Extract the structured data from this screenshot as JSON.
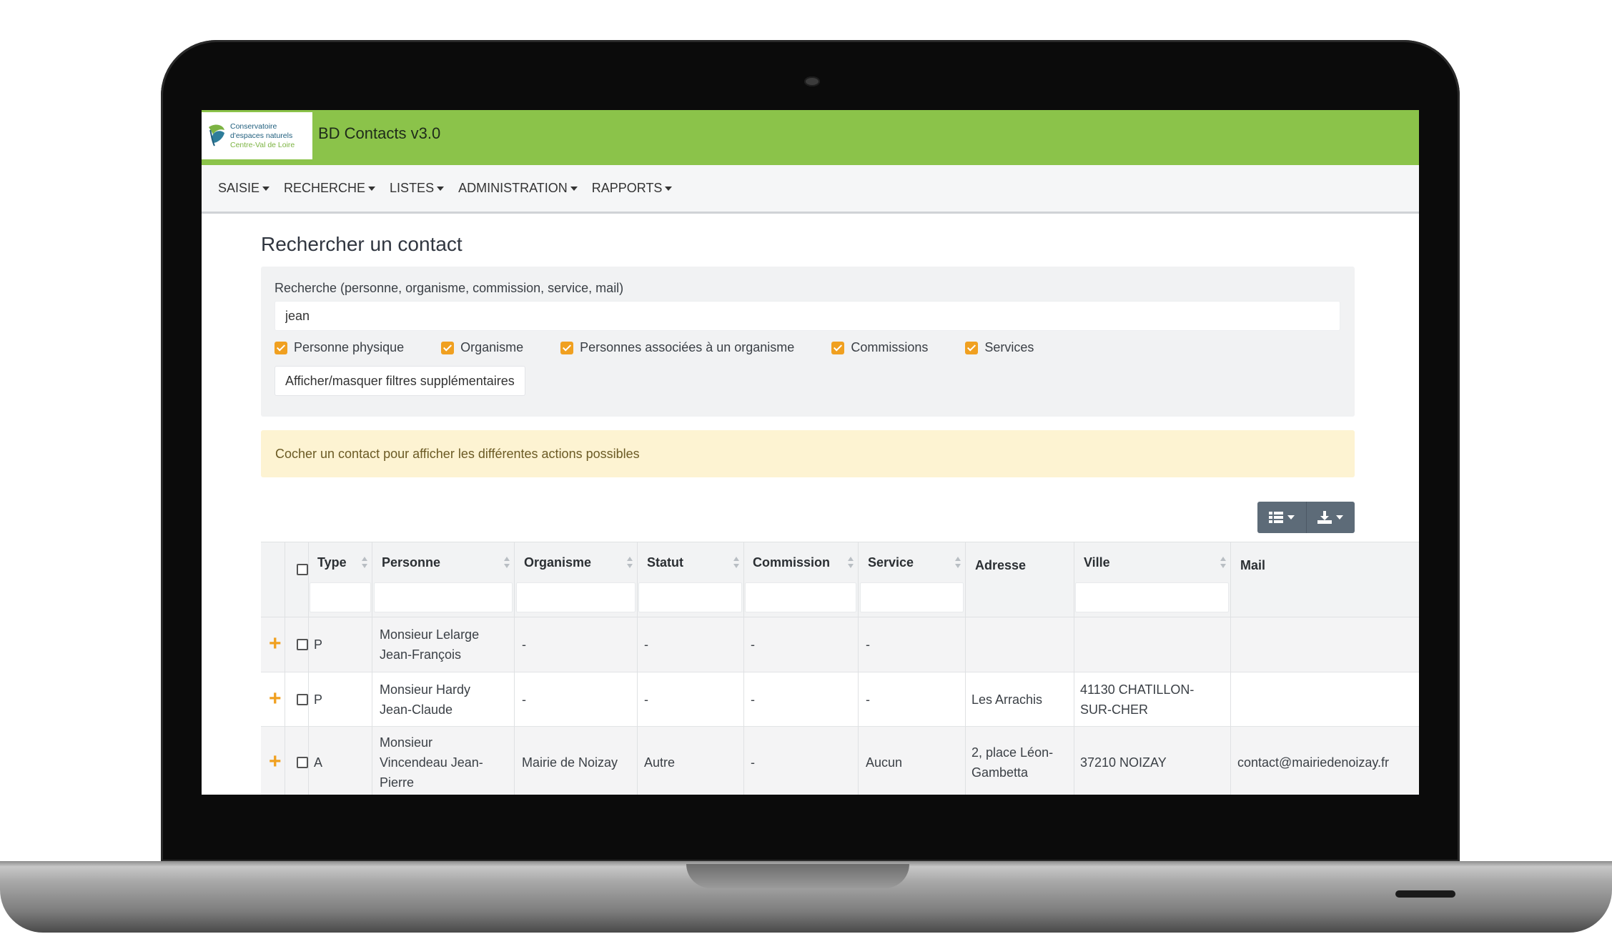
{
  "app": {
    "title": "BD Contacts v3.0",
    "logo_line1": "Conservatoire",
    "logo_line2": "d'espaces naturels",
    "logo_line3": "Centre-Val de Loire"
  },
  "nav": [
    "SAISIE",
    "RECHERCHE",
    "LISTES",
    "ADMINISTRATION",
    "RAPPORTS"
  ],
  "page": {
    "title": "Rechercher un contact"
  },
  "search": {
    "label": "Recherche (personne, organisme, commission, service, mail)",
    "value": "jean",
    "checkboxes": [
      "Personne physique",
      "Organisme",
      "Personnes associées à un organisme",
      "Commissions",
      "Services"
    ],
    "toggle_label": "Afficher/masquer filtres supplémentaires"
  },
  "alert": {
    "text": "Cocher un contact pour afficher les différentes actions possibles"
  },
  "table": {
    "columns": [
      "Type",
      "Personne",
      "Organisme",
      "Statut",
      "Commission",
      "Service",
      "Adresse",
      "Ville",
      "Mail"
    ],
    "rows": [
      {
        "type": "P",
        "personne": [
          "Monsieur Lelarge",
          "Jean-François"
        ],
        "organisme": "-",
        "statut": "-",
        "commission": "-",
        "service": "-",
        "adresse": [],
        "ville": [],
        "mail": ""
      },
      {
        "type": "P",
        "personne": [
          "Monsieur Hardy",
          "Jean-Claude"
        ],
        "organisme": "-",
        "statut": "-",
        "commission": "-",
        "service": "-",
        "adresse": [
          "Les Arrachis"
        ],
        "ville": [
          "41130 CHATILLON-",
          "SUR-CHER"
        ],
        "mail": ""
      },
      {
        "type": "A",
        "personne": [
          "Monsieur",
          "Vincendeau Jean-",
          "Pierre"
        ],
        "organisme": "Mairie de Noizay",
        "statut": "Autre",
        "commission": "-",
        "service": "Aucun",
        "adresse": [
          "2, place Léon-",
          "Gambetta"
        ],
        "ville": [
          "37210 NOIZAY"
        ],
        "mail": "contact@mairiedenoizay.fr"
      }
    ]
  },
  "colors": {
    "header_green": "#8bc34a",
    "accent_orange": "#f0a020",
    "toolbar": "#5d6b78",
    "alert_bg": "#fdf3d2"
  }
}
